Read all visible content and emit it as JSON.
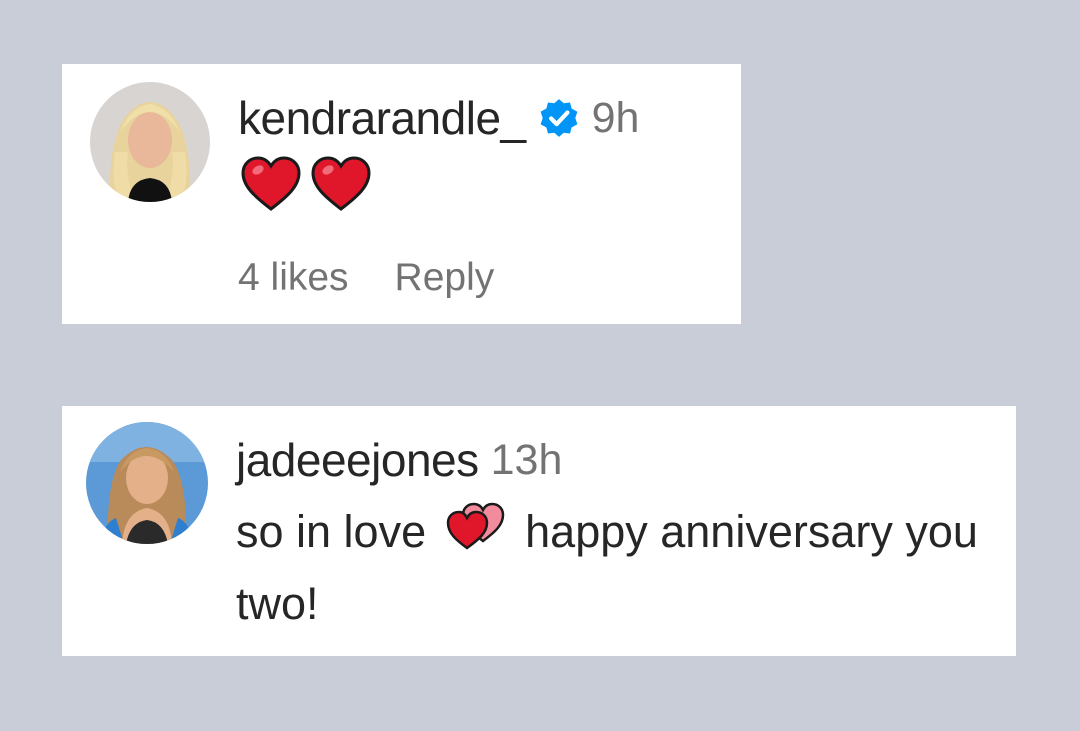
{
  "comments": [
    {
      "username": "kendrarandle_",
      "verified": true,
      "time": "9h",
      "text_emoji": [
        "red-heart-emoji",
        "red-heart-emoji"
      ],
      "likes_label": "4 likes",
      "reply_label": "Reply"
    },
    {
      "username": "jadeeejones",
      "verified": false,
      "time": "13h",
      "text_before": "so in love",
      "text_emoji": [
        "two-hearts-emoji"
      ],
      "text_after": "happy anniversary you two!"
    }
  ],
  "colors": {
    "background": "#c9cdd8",
    "card": "#ffffff",
    "username": "#262626",
    "meta": "#737373",
    "verified": "#0095f6",
    "heart": "#e0162b"
  }
}
